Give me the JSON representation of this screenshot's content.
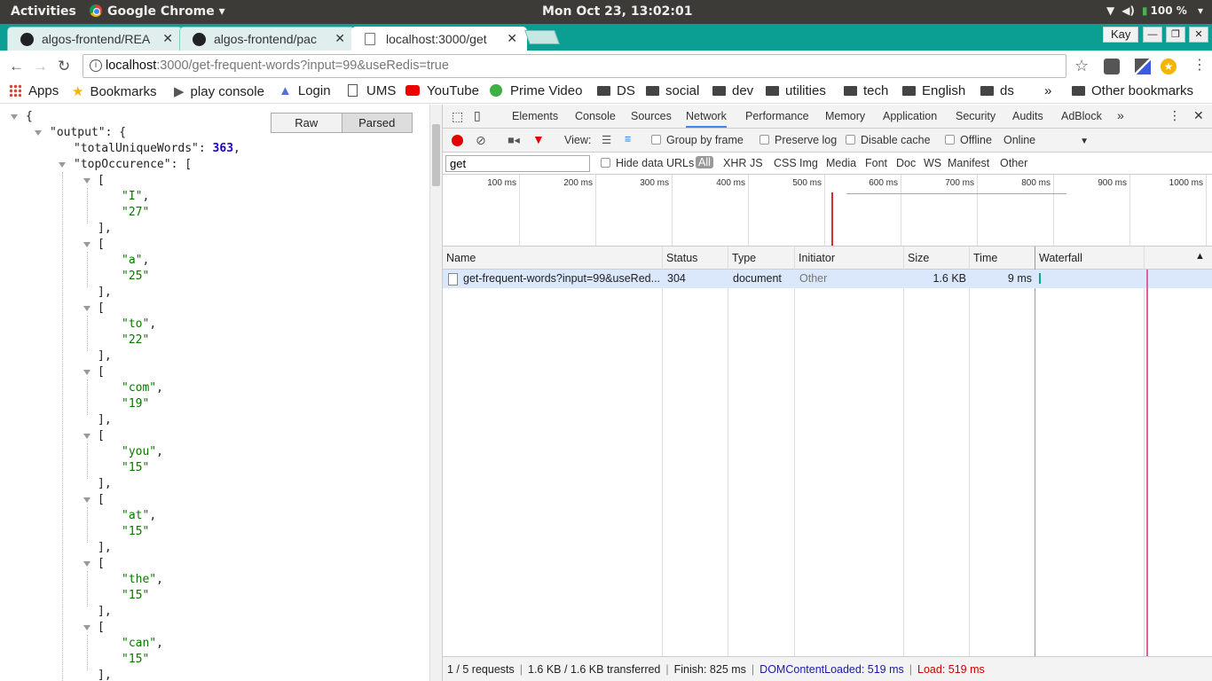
{
  "os_bar": {
    "activities": "Activities",
    "app": "Google Chrome",
    "clock": "Mon Oct 23, 13:02:01",
    "battery": "100 %"
  },
  "tabs": [
    {
      "title": "algos-frontend/REA"
    },
    {
      "title": "algos-frontend/pac"
    },
    {
      "title": "localhost:3000/get"
    }
  ],
  "profile": "Kay",
  "address": {
    "host": "localhost",
    "path": ":3000/get-frequent-words?input=99&useRedis=true"
  },
  "bookmarks": [
    "Apps",
    "Bookmarks",
    "play console",
    "Login",
    "UMS",
    "YouTube",
    "Prime Video",
    "DS",
    "social",
    "dev",
    "utilities",
    "tech",
    "English",
    "ds"
  ],
  "other_bookmarks": "Other bookmarks",
  "overflow": "»",
  "json_view": {
    "raw": "Raw",
    "parsed": "Parsed",
    "open_brace": "{",
    "output_key": "\"output\"",
    "output_open": ": {",
    "total_key": "\"totalUniqueWords\"",
    "total_val": "363",
    "top_key": "\"topOccurence\"",
    "top_open": ": [",
    "pairs": [
      [
        "\"I\"",
        "\"27\""
      ],
      [
        "\"a\"",
        "\"25\""
      ],
      [
        "\"to\"",
        "\"22\""
      ],
      [
        "\"com\"",
        "\"19\""
      ],
      [
        "\"you\"",
        "\"15\""
      ],
      [
        "\"at\"",
        "\"15\""
      ],
      [
        "\"the\"",
        "\"15\""
      ],
      [
        "\"can\"",
        "\"15\""
      ]
    ]
  },
  "devtools": {
    "tabs": [
      "Elements",
      "Console",
      "Sources",
      "Network",
      "Performance",
      "Memory",
      "Application",
      "Security",
      "Audits",
      "AdBlock"
    ],
    "more": "»",
    "view_label": "View:",
    "group_by_frame": "Group by frame",
    "preserve_log": "Preserve log",
    "disable_cache": "Disable cache",
    "offline": "Offline",
    "online": "Online",
    "filter_value": "get",
    "hide_data_urls": "Hide data URLs",
    "type_filters": [
      "All",
      "XHR",
      "JS",
      "CSS",
      "Img",
      "Media",
      "Font",
      "Doc",
      "WS",
      "Manifest",
      "Other"
    ],
    "timeline_ticks": [
      "100 ms",
      "200 ms",
      "300 ms",
      "400 ms",
      "500 ms",
      "600 ms",
      "700 ms",
      "800 ms",
      "900 ms",
      "1000 ms"
    ],
    "columns": [
      "Name",
      "Status",
      "Type",
      "Initiator",
      "Size",
      "Time",
      "Waterfall"
    ],
    "row": {
      "name": "get-frequent-words?input=99&useRed...",
      "status": "304",
      "type": "document",
      "initiator": "Other",
      "size": "1.6 KB",
      "time": "9 ms"
    },
    "status_bar": {
      "requests": "1 / 5 requests",
      "transferred": "1.6 KB / 1.6 KB transferred",
      "finish": "Finish: 825 ms",
      "dcl": "DOMContentLoaded: 519 ms",
      "load": "Load: 519 ms"
    }
  }
}
